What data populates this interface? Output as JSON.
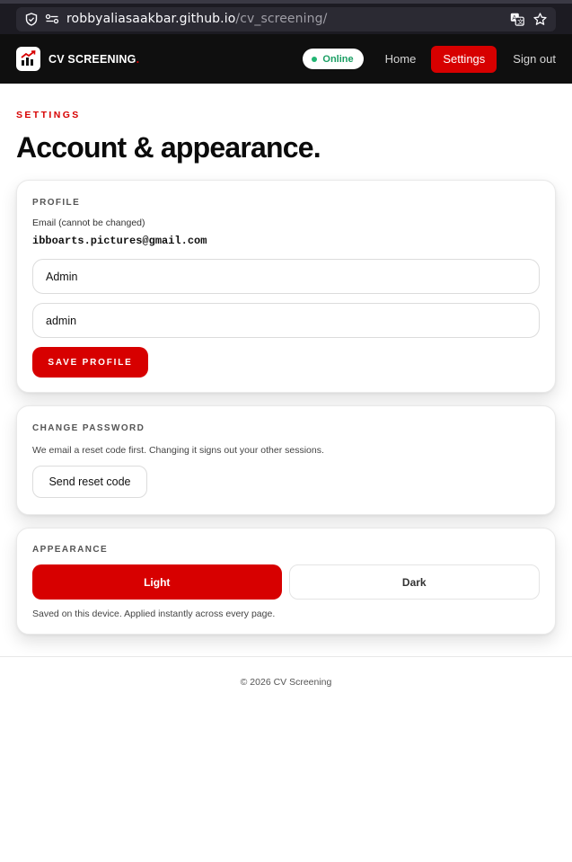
{
  "browser": {
    "url_host": "robbyaliasaakbar.github.io",
    "url_path": "/cv_screening/"
  },
  "nav": {
    "brand": "CV SCREENING",
    "brand_dot": ".",
    "status": "Online",
    "home": "Home",
    "settings": "Settings",
    "sign_out": "Sign out"
  },
  "page": {
    "eyebrow": "SETTINGS",
    "title": "Account & appearance."
  },
  "profile": {
    "heading": "PROFILE",
    "email_label": "Email (cannot be changed)",
    "email_value": "ibboarts.pictures@gmail.com",
    "display_name_value": "Admin",
    "username_value": "admin",
    "save_label": "SAVE PROFILE"
  },
  "password": {
    "heading": "CHANGE PASSWORD",
    "help": "We email a reset code first. Changing it signs out your other sessions.",
    "reset_label": "Send reset code"
  },
  "appearance": {
    "heading": "APPEARANCE",
    "light_label": "Light",
    "dark_label": "Dark",
    "selected": "Light",
    "note": "Saved on this device. Applied instantly across every page."
  },
  "footer": {
    "text": "© 2026 CV Screening"
  },
  "colors": {
    "accent": "#d70000",
    "nav_bg": "#0f0f0f",
    "online": "#22b573"
  },
  "icons": [
    "shield-icon",
    "connection-icon",
    "translate-icon",
    "bookmark-star-icon",
    "logo-chart-icon"
  ]
}
